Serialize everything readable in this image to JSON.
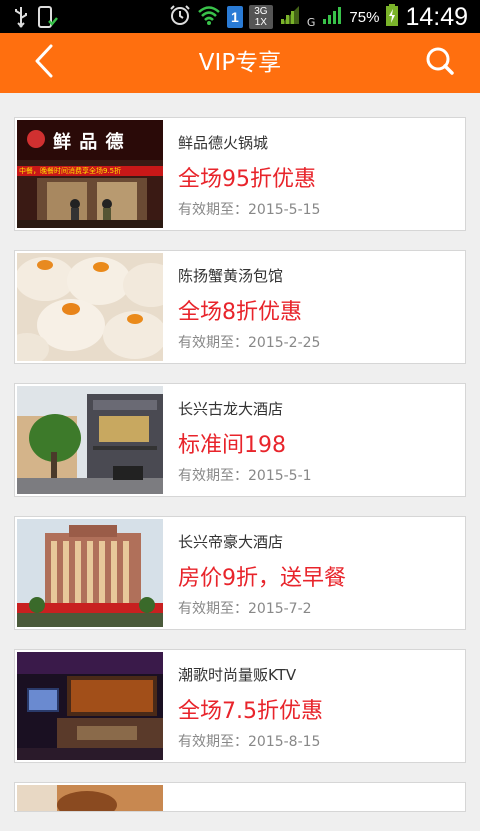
{
  "status_bar": {
    "battery_pct": "75%",
    "time": "14:49",
    "network_label": "G",
    "sim_badge": "1",
    "net_badge_top": "3G",
    "net_badge_bottom": "1X"
  },
  "header": {
    "title": "VIP专享"
  },
  "items": [
    {
      "name": "鲜品德火锅城",
      "promo": "全场95折优惠",
      "expiry": "有效期至：2015-5-15"
    },
    {
      "name": "陈扬蟹黄汤包馆",
      "promo": "全场8折优惠",
      "expiry": "有效期至：2015-2-25"
    },
    {
      "name": "长兴古龙大酒店",
      "promo": "标准间198",
      "expiry": "有效期至：2015-5-1"
    },
    {
      "name": "长兴帝豪大酒店",
      "promo": "房价9折，送早餐",
      "expiry": "有效期至：2015-7-2"
    },
    {
      "name": "潮歌时尚量贩KTV",
      "promo": "全场7.5折优惠",
      "expiry": "有效期至：2015-8-15"
    }
  ],
  "thumb_text": {
    "restaurant_sign": "鲜 品 德",
    "restaurant_sub": "中餐，晚餐时间消费享全场9.5折"
  },
  "colors": {
    "accent": "#ff6f0f",
    "promo_red": "#e8242b"
  }
}
